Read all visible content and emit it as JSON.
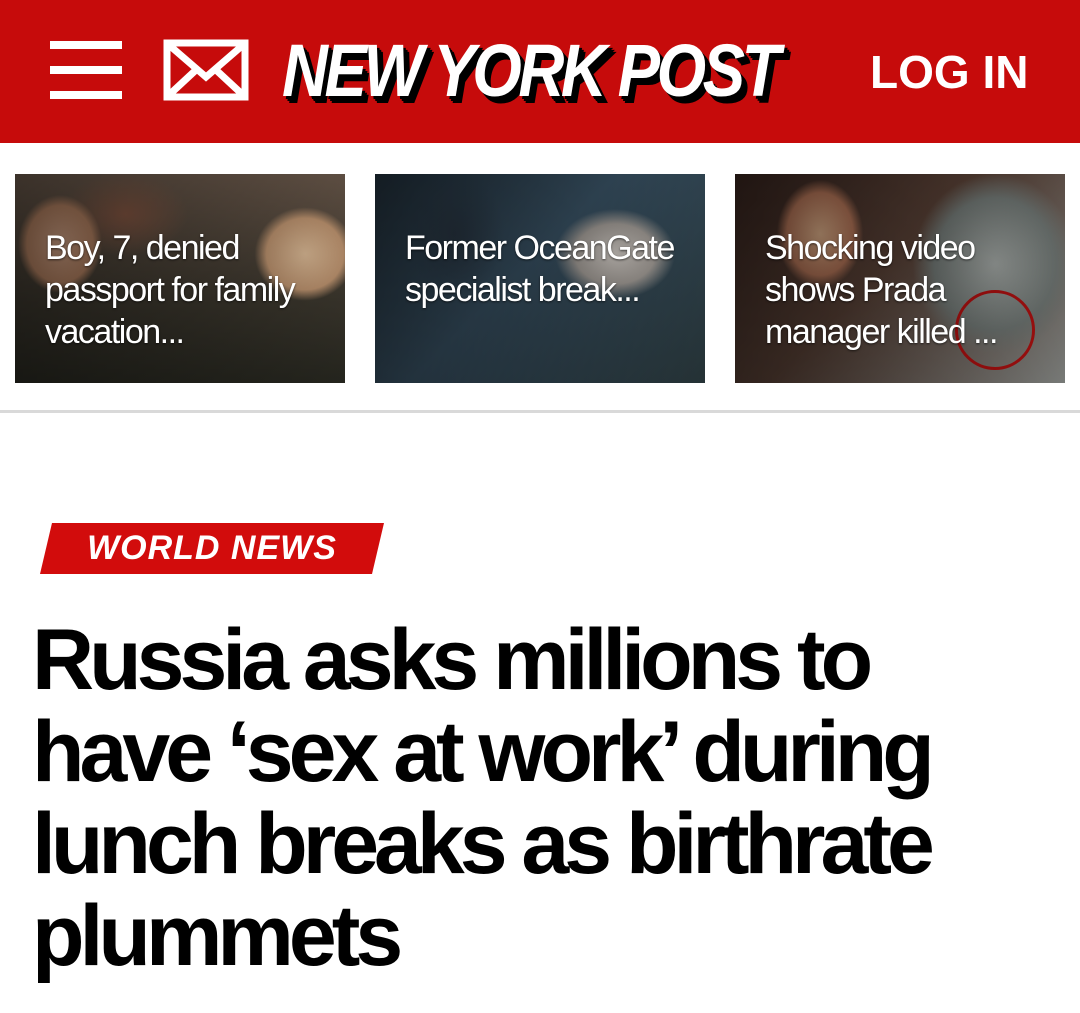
{
  "header": {
    "brand": "NEW YORK POST",
    "login_label": "LOG IN",
    "menu_icon": "hamburger-menu-icon",
    "mail_icon": "envelope-icon",
    "background_color": "#c60b0b"
  },
  "stories": [
    {
      "title": "Boy, 7, denied passport for family vacation..."
    },
    {
      "title": "Former OceanGate specialist break..."
    },
    {
      "title": "Shocking video shows Prada manager killed ..."
    }
  ],
  "article": {
    "section": "WORLD NEWS",
    "section_color": "#d20c0c",
    "headline": "Russia asks millions to have ‘sex at work’ during lunch breaks as birthrate plummets"
  }
}
